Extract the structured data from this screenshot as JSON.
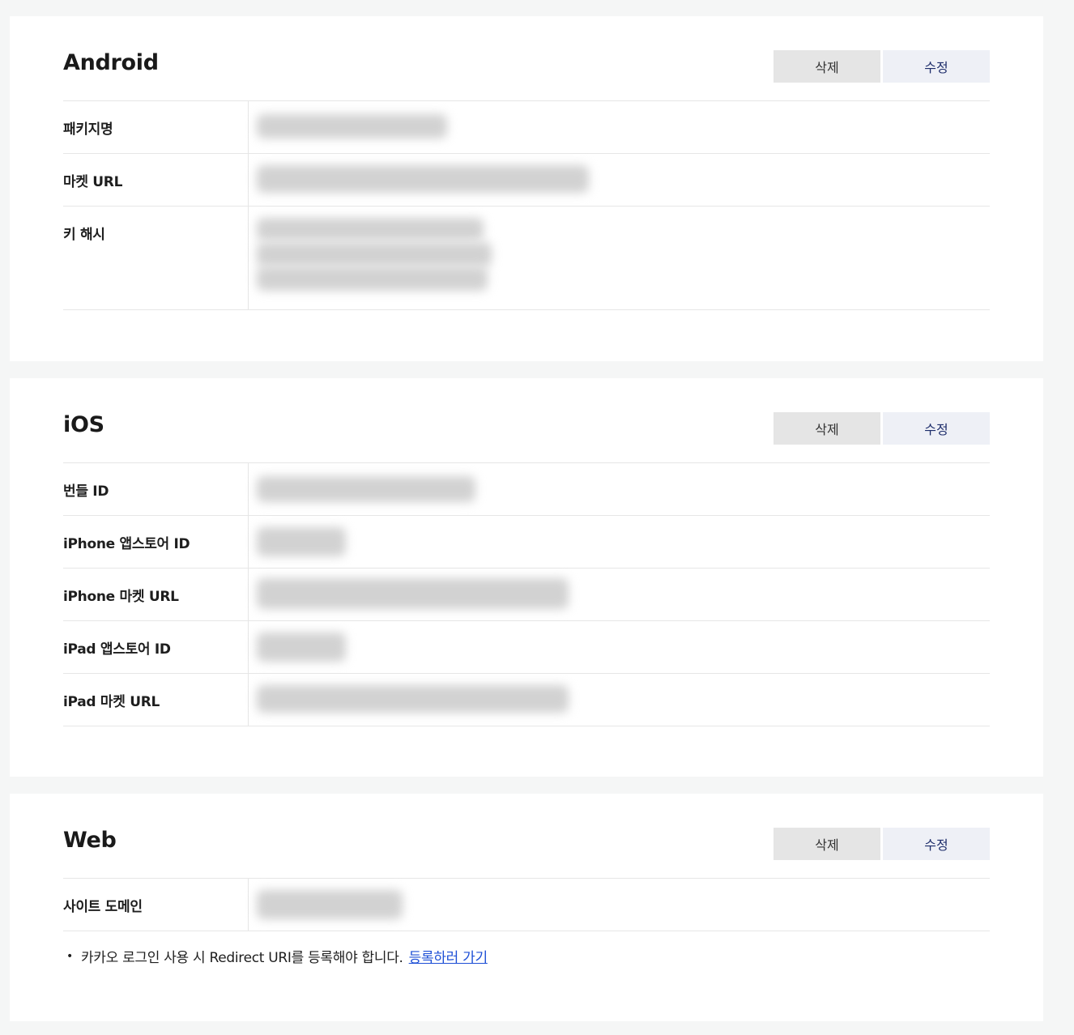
{
  "android": {
    "title": "Android",
    "delete_label": "삭제",
    "edit_label": "수정",
    "rows": [
      {
        "label": "패키지명"
      },
      {
        "label": "마켓 URL"
      },
      {
        "label": "키 해시"
      }
    ]
  },
  "ios": {
    "title": "iOS",
    "delete_label": "삭제",
    "edit_label": "수정",
    "rows": [
      {
        "label": "번들 ID"
      },
      {
        "label": "iPhone 앱스토어 ID"
      },
      {
        "label": "iPhone 마켓 URL"
      },
      {
        "label": "iPad 앱스토어 ID"
      },
      {
        "label": "iPad 마켓 URL"
      }
    ]
  },
  "web": {
    "title": "Web",
    "delete_label": "삭제",
    "edit_label": "수정",
    "rows": [
      {
        "label": "사이트 도메인"
      }
    ],
    "note_text": "카카오 로그인 사용 시 Redirect URI를 등록해야 합니다.",
    "note_link": "등록하러 가기"
  }
}
